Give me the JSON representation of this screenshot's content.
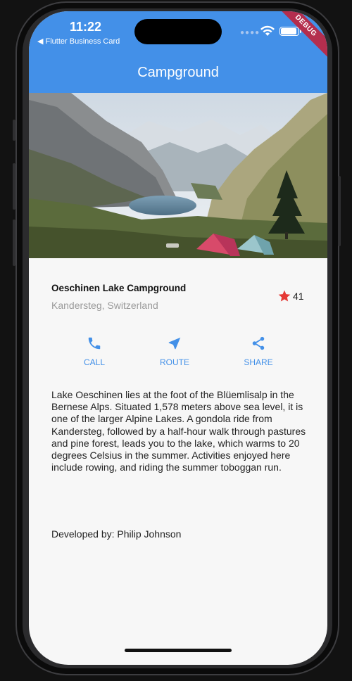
{
  "status": {
    "time": "11:22",
    "back_label": "◀ Flutter Business Card",
    "debug_label": "DEBUG"
  },
  "appbar": {
    "title": "Campground",
    "color": "#4390e8"
  },
  "place": {
    "name": "Oeschinen Lake Campground",
    "location": "Kandersteg, Switzerland",
    "rating": "41"
  },
  "actions": [
    {
      "icon": "phone-icon",
      "label": "CALL"
    },
    {
      "icon": "navigation-arrow-icon",
      "label": "ROUTE"
    },
    {
      "icon": "share-icon",
      "label": "SHARE"
    }
  ],
  "description": "Lake Oeschinen lies at the foot of the Blüemlisalp in the Bernese Alps. Situated 1,578 meters above sea level, it is one of the larger Alpine Lakes. A gondola ride from Kandersteg, followed by a half-hour walk through pastures and pine forest, leads you to the lake, which warms to 20 degrees Celsius in the summer. Activities enjoyed here include rowing, and riding the summer toboggan run.",
  "developer": "Developed by: Philip Johnson"
}
